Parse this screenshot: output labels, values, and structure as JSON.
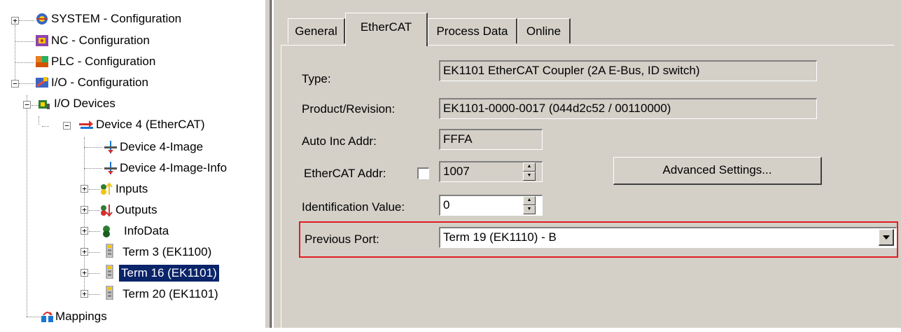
{
  "tree": {
    "items": [
      {
        "label": "SYSTEM - Configuration",
        "icon": "system-config-icon"
      },
      {
        "label": "NC - Configuration",
        "icon": "nc-config-icon"
      },
      {
        "label": "PLC - Configuration",
        "icon": "plc-config-icon"
      },
      {
        "label": "I/O - Configuration",
        "icon": "io-config-icon"
      },
      {
        "label": "I/O Devices",
        "icon": "io-devices-icon"
      },
      {
        "label": "Device 4 (EtherCAT)",
        "icon": "ethercat-device-icon"
      },
      {
        "label": "Device 4-Image",
        "icon": "image-icon"
      },
      {
        "label": "Device 4-Image-Info",
        "icon": "image-info-icon"
      },
      {
        "label": "Inputs",
        "icon": "inputs-icon"
      },
      {
        "label": "Outputs",
        "icon": "outputs-icon"
      },
      {
        "label": "InfoData",
        "icon": "infodata-icon"
      },
      {
        "label": "Term 3 (EK1100)",
        "icon": "terminal-icon"
      },
      {
        "label": "Term 16 (EK1101)",
        "icon": "terminal-icon"
      },
      {
        "label": "Term 20 (EK1101)",
        "icon": "terminal-icon"
      },
      {
        "label": "Mappings",
        "icon": "mappings-icon"
      }
    ],
    "selected": "Term 16 (EK1101)"
  },
  "tabs": [
    {
      "label": "General"
    },
    {
      "label": "EtherCAT"
    },
    {
      "label": "Process Data"
    },
    {
      "label": "Online"
    }
  ],
  "active_tab": "EtherCAT",
  "form": {
    "type_label": "Type:",
    "type_value": "EK1101 EtherCAT Coupler (2A E-Bus, ID switch)",
    "product_label": "Product/Revision:",
    "product_value": "EK1101-0000-0017 (044d2c52 / 00110000)",
    "autoinc_label": "Auto Inc Addr:",
    "autoinc_value": "FFFA",
    "ethercat_addr_label": "EtherCAT Addr:",
    "ethercat_addr_value": "1007",
    "ethercat_addr_checked": false,
    "advanced_button": "Advanced Settings...",
    "ident_label": "Identification Value:",
    "ident_value": "0",
    "prev_port_label": "Previous Port:",
    "prev_port_value": "Term 19 (EK1110) - B"
  },
  "colors": {
    "highlight": "#e31b23",
    "selection": "#0a246a",
    "panel": "#d4d0c8"
  }
}
